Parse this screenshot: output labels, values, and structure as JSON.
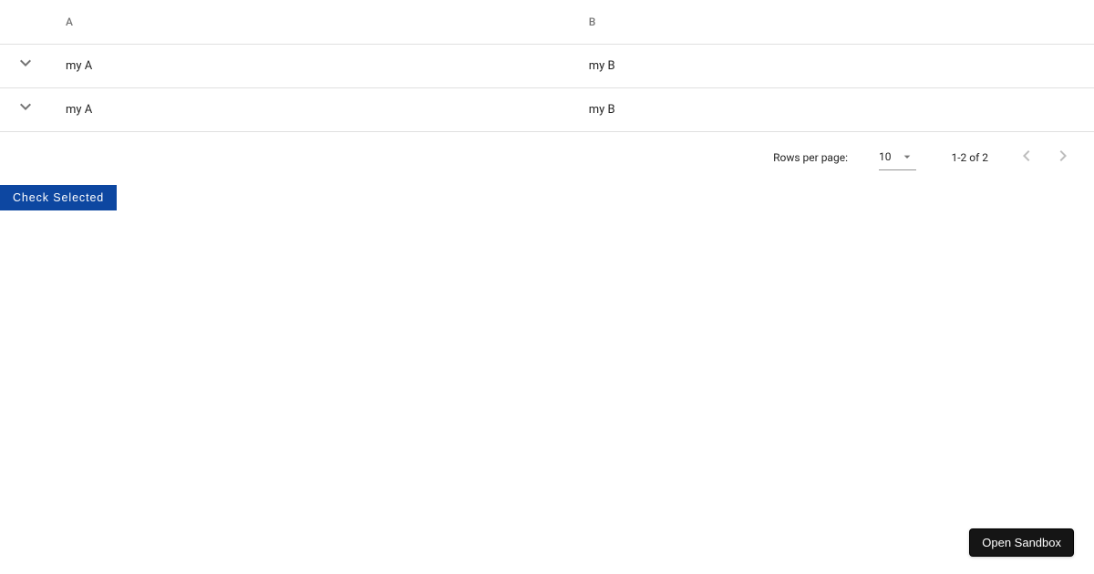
{
  "table": {
    "columns": {
      "a": "A",
      "b": "B"
    },
    "rows": [
      {
        "a": "my A",
        "b": "my B"
      },
      {
        "a": "my A",
        "b": "my B"
      }
    ]
  },
  "pagination": {
    "rows_label": "Rows per page:",
    "page_size": "10",
    "range_text": "1-2 of 2"
  },
  "actions": {
    "check_selected": "Check Selected",
    "open_sandbox": "Open Sandbox"
  }
}
